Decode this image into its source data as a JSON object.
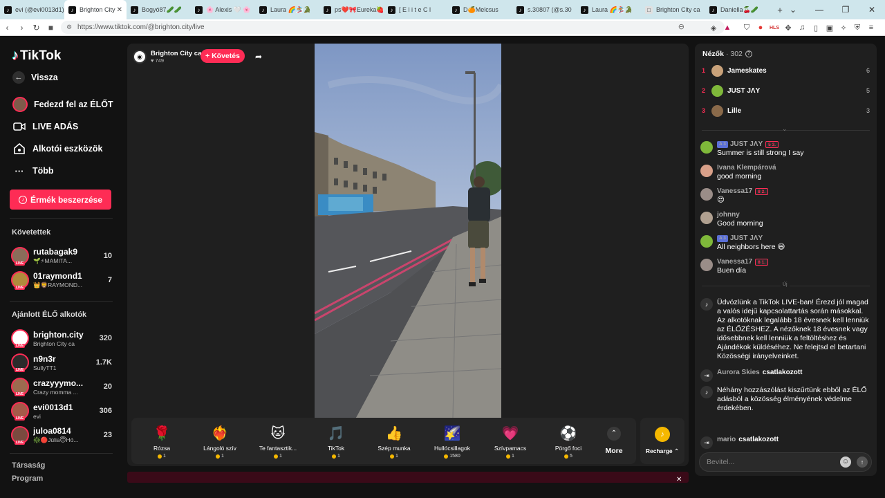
{
  "browser": {
    "tabs": [
      {
        "label": "evi (@evi0013d1)",
        "active": false
      },
      {
        "label": "Brighton City",
        "active": true
      },
      {
        "label": "Bogyó87🥒🥒",
        "active": false
      },
      {
        "label": "🌸 Alexis 🤍 🌸",
        "active": false
      },
      {
        "label": "Laura 🌈🏂🐊",
        "active": false
      },
      {
        "label": "ps❤️🎀Eureka🍓",
        "active": false
      },
      {
        "label": "[ E l i t e C l",
        "active": false
      },
      {
        "label": "D🍊Melcsus",
        "active": false
      },
      {
        "label": "s.30807 (@s.30",
        "active": false
      },
      {
        "label": "Laura 🌈🏂🐊",
        "active": false
      },
      {
        "label": "Brighton City ca",
        "active": false
      },
      {
        "label": "Daniella🍒🥒",
        "active": false
      }
    ],
    "url": "https://www.tiktok.com/@brighton.city/live"
  },
  "sidebar": {
    "logo": "TikTok",
    "back": "Vissza",
    "nav": [
      {
        "label": "Fedezd fel az ÉLŐT",
        "icon": "explore-live-icon"
      },
      {
        "label": "LIVE ADÁS",
        "icon": "camera-icon"
      },
      {
        "label": "Alkotói eszközök",
        "icon": "creator-tools-icon"
      },
      {
        "label": "Több",
        "icon": "more-icon"
      }
    ],
    "coins_button": "Érmék beszerzése",
    "following_title": "Követettek",
    "following": [
      {
        "name": "rutabagak9",
        "sub": "🌱⚡MAMITA...",
        "count": "10",
        "color": "#8a6d5a"
      },
      {
        "name": "01raymond1",
        "sub": "👑🦁RAYMOND...",
        "count": "7",
        "color": "#b08b3c"
      }
    ],
    "recommended_title": "Ajánlott ÉLŐ alkotók",
    "recommended": [
      {
        "name": "brighton.city",
        "sub": "Brighton City ca",
        "count": "320",
        "color": "#ffffff"
      },
      {
        "name": "n9n3r",
        "sub": "SullyTT1",
        "count": "1.7K",
        "color": "#2b2b2b"
      },
      {
        "name": "crazyyymo...",
        "sub": "Crazy momma ...",
        "count": "20",
        "color": "#9c6b4f"
      },
      {
        "name": "evi0013d1",
        "sub": "evi",
        "count": "306",
        "color": "#a55a49"
      },
      {
        "name": "juloa0814",
        "sub": "❇️🔴Júlia😇Hó...",
        "count": "23",
        "color": "#7a4a3f"
      }
    ],
    "footer": [
      "Társaság",
      "Program"
    ]
  },
  "stage": {
    "streamer_name": "Brighton City ca",
    "likes": "749",
    "follow_label": "+ Követés",
    "gifts": [
      {
        "name": "Rózsa",
        "price": "1",
        "icon": "🌹"
      },
      {
        "name": "Lángoló szív",
        "price": "1",
        "icon": "❤️‍🔥"
      },
      {
        "name": "Te fantasztik...",
        "price": "1",
        "icon": "🐱"
      },
      {
        "name": "TikTok",
        "price": "1",
        "icon": "🎵"
      },
      {
        "name": "Szép munka",
        "price": "1",
        "icon": "👍"
      },
      {
        "name": "Hullócsillagok",
        "price": "1580",
        "icon": "🌠"
      },
      {
        "name": "Szívpamacs",
        "price": "1",
        "icon": "💗"
      },
      {
        "name": "Pörgő foci",
        "price": "5",
        "icon": "⚽"
      }
    ],
    "more_label": "More",
    "recharge_label": "Recharge"
  },
  "chat": {
    "viewers_title": "Nézők",
    "viewers_count": "· 302",
    "top_viewers": [
      {
        "rank": "1",
        "name": "Jameskates",
        "score": "6",
        "color": "#c9a27a"
      },
      {
        "rank": "2",
        "name": "JUST JΛY",
        "score": "5",
        "color": "#7fb83a"
      },
      {
        "rank": "3",
        "name": "Lille",
        "score": "3",
        "color": "#8a6a4a"
      }
    ],
    "messages": [
      {
        "user": "JUST JΛY",
        "level": "A 3",
        "fan": "5 3.",
        "text": "Summer is still strong I say",
        "color": "#7fb83a"
      },
      {
        "user": "Ivana Klempárová",
        "text": "good morning",
        "color": "#d9a089"
      },
      {
        "user": "Vanessa17",
        "fan": "8 2.",
        "text": "😍",
        "color": "#9a8d88"
      },
      {
        "user": "johnny",
        "text": "Good morning",
        "color": "#b0a090"
      },
      {
        "user": "JUST JΛY",
        "level": "A 3",
        "text": "All neighbors here 😄",
        "color": "#7fb83a"
      },
      {
        "user": "Vanessa17",
        "fan": "8 1.",
        "text": "Buen día",
        "color": "#9a8d88"
      }
    ],
    "new_label": "Új",
    "welcome": "Üdvözlünk a TikTok LIVE-ban! Érezd jól magad a valós idejű kapcsolattartás során másokkal. Az alkotóknak legalább 18 évesnek kell lenniük az ÉLŐZÉSHEZ. A nézőknek 18 évesnek vagy idősebbnek kell lenniük a feltöltéshez és Ajándékok küldéséhez. Ne felejtsd el betartani Közösségi irányelveinket.",
    "joined1_user": "Aurora Skies",
    "joined1_text": "csatlakozott",
    "filtered_notice": "Néhány hozzászólást kiszűrtünk ebből az ÉLŐ adásból a közösség élményének védelme érdekében.",
    "joined2_user": "mario",
    "joined2_text": "csatlakozott",
    "input_placeholder": "Bevitel..."
  }
}
